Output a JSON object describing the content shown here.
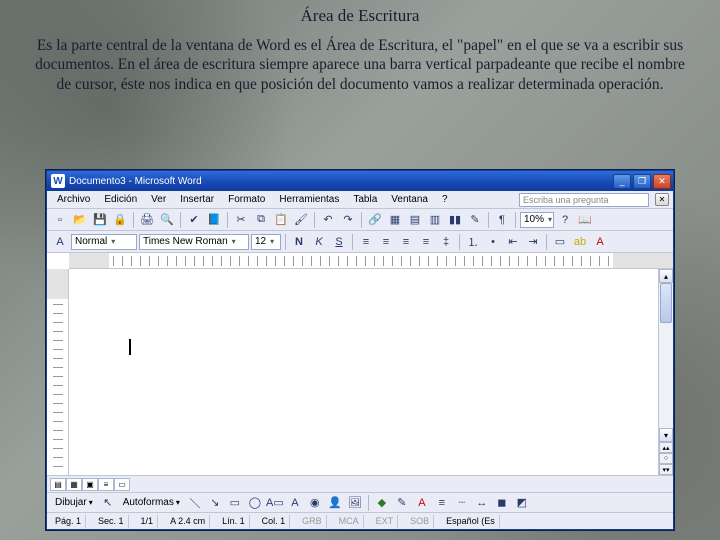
{
  "page": {
    "title": "Área de Escritura",
    "body": "Es la parte central de la ventana de Word es el Área de Escritura, el \"papel\" en el que se va a escribir sus documentos. En el área de escritura siempre aparece una barra vertical parpadeante que recibe el nombre de cursor, éste nos indica en que posición del documento vamos a realizar determinada operación."
  },
  "window": {
    "title": "Documento3 - Microsoft Word",
    "help_placeholder": "Escriba una pregunta"
  },
  "menus": [
    "Archivo",
    "Edición",
    "Ver",
    "Insertar",
    "Formato",
    "Herramientas",
    "Tabla",
    "Ventana",
    "?"
  ],
  "format": {
    "style": "Normal",
    "font": "Times New Roman",
    "size": "12",
    "zoom": "10%"
  },
  "drawbar": {
    "draw": "Dibujar",
    "autoshapes": "Autoformas"
  },
  "status": {
    "page": "Pág. 1",
    "sec": "Sec. 1",
    "pages": "1/1",
    "at": "A 2.4 cm",
    "line": "Lín. 1",
    "col": "Col. 1",
    "ind1": "GRB",
    "ind2": "MCA",
    "ind3": "EXT",
    "ind4": "SOB",
    "lang": "Español (Es"
  }
}
